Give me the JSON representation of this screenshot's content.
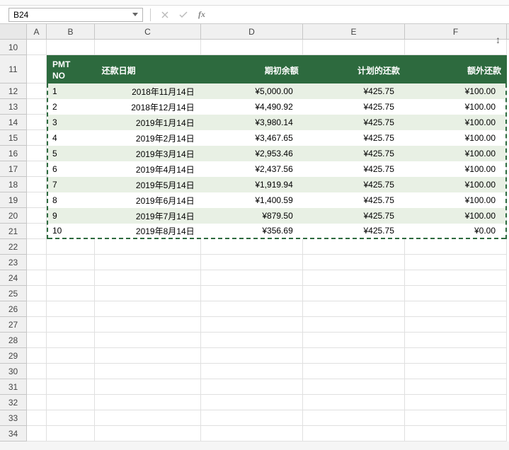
{
  "name_box": "B24",
  "formula_value": "",
  "columns": [
    "A",
    "B",
    "C",
    "D",
    "E",
    "F"
  ],
  "row_start": 10,
  "row_end": 34,
  "table": {
    "headers": {
      "pmt_no": "PMT\nNO",
      "date": "还款日期",
      "opening": "期初余额",
      "planned": "计划的还款",
      "extra": "额外还款"
    },
    "rows": [
      {
        "no": "1",
        "date": "2018年11月14日",
        "opening": "¥5,000.00",
        "planned": "¥425.75",
        "extra": "¥100.00"
      },
      {
        "no": "2",
        "date": "2018年12月14日",
        "opening": "¥4,490.92",
        "planned": "¥425.75",
        "extra": "¥100.00"
      },
      {
        "no": "3",
        "date": "2019年1月14日",
        "opening": "¥3,980.14",
        "planned": "¥425.75",
        "extra": "¥100.00"
      },
      {
        "no": "4",
        "date": "2019年2月14日",
        "opening": "¥3,467.65",
        "planned": "¥425.75",
        "extra": "¥100.00"
      },
      {
        "no": "5",
        "date": "2019年3月14日",
        "opening": "¥2,953.46",
        "planned": "¥425.75",
        "extra": "¥100.00"
      },
      {
        "no": "6",
        "date": "2019年4月14日",
        "opening": "¥2,437.56",
        "planned": "¥425.75",
        "extra": "¥100.00"
      },
      {
        "no": "7",
        "date": "2019年5月14日",
        "opening": "¥1,919.94",
        "planned": "¥425.75",
        "extra": "¥100.00"
      },
      {
        "no": "8",
        "date": "2019年6月14日",
        "opening": "¥1,400.59",
        "planned": "¥425.75",
        "extra": "¥100.00"
      },
      {
        "no": "9",
        "date": "2019年7月14日",
        "opening": "¥879.50",
        "planned": "¥425.75",
        "extra": "¥100.00"
      },
      {
        "no": "10",
        "date": "2019年8月14日",
        "opening": "¥356.69",
        "planned": "¥425.75",
        "extra": "¥0.00"
      }
    ]
  }
}
